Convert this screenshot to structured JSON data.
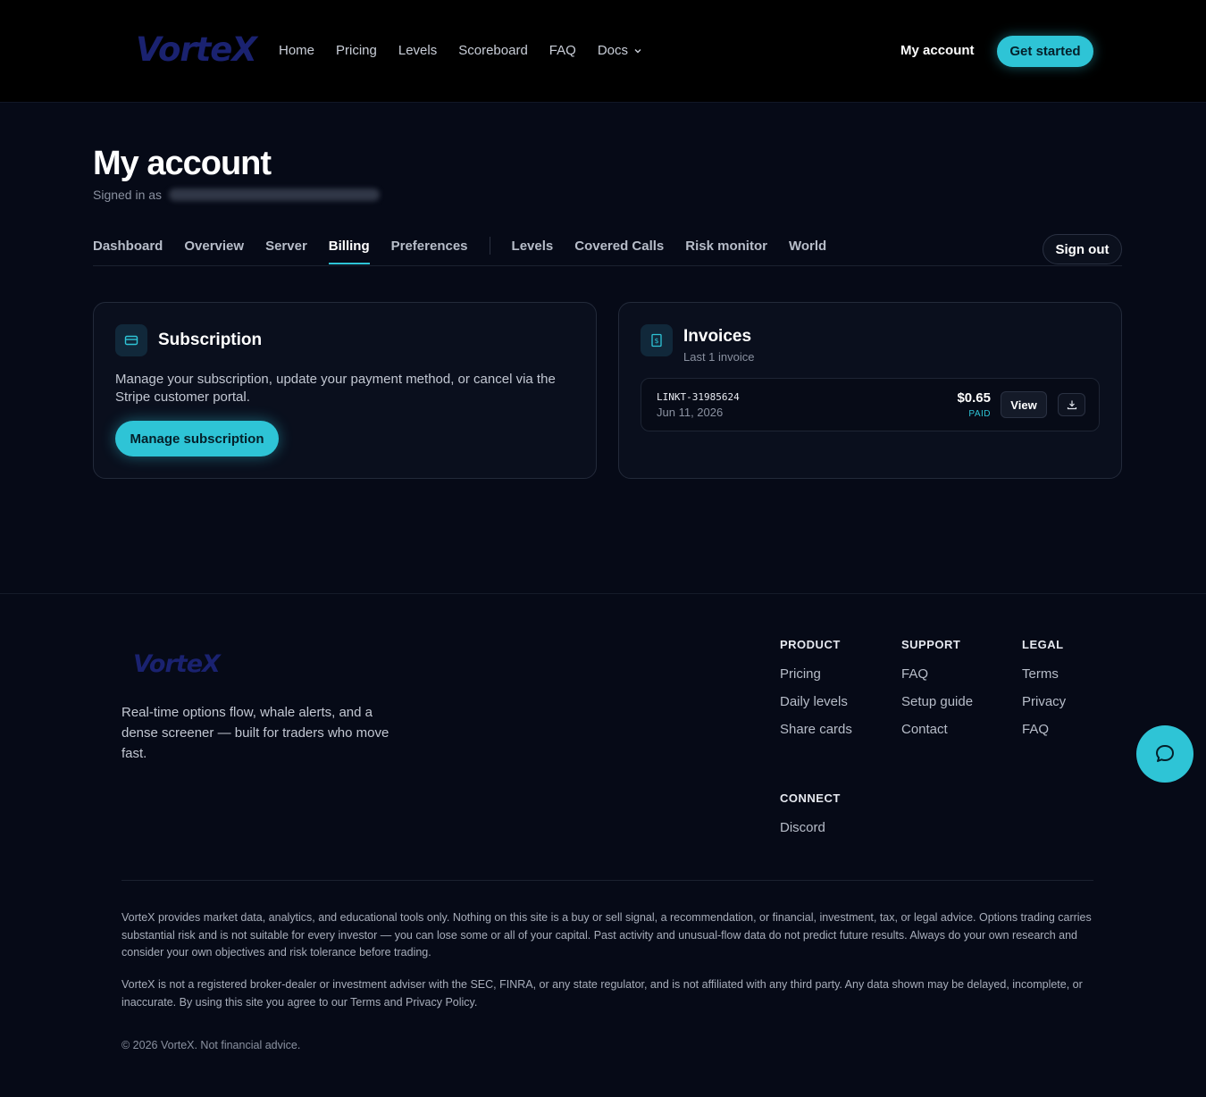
{
  "header": {
    "logo": "VorteX",
    "nav": [
      "Home",
      "Pricing",
      "Levels",
      "Scoreboard",
      "FAQ",
      "Docs"
    ],
    "account_link": "My account",
    "cta": "Get started"
  },
  "main": {
    "title": "My account",
    "signed_in_label": "Signed in as",
    "tabs_left": [
      "Dashboard",
      "Overview",
      "Server",
      "Billing",
      "Preferences"
    ],
    "tabs_right": [
      "Levels",
      "Covered Calls",
      "Risk monitor",
      "World"
    ],
    "active_tab": "Billing",
    "sign_out": "Sign out"
  },
  "subscription": {
    "title": "Subscription",
    "description": "Manage your subscription, update your payment method, or cancel via the Stripe customer portal.",
    "button": "Manage subscription"
  },
  "invoices": {
    "title": "Invoices",
    "subtitle": "Last 1 invoice",
    "items": [
      {
        "id": "LINKT-31985624",
        "date": "Jun 11, 2026",
        "amount": "$0.65",
        "status": "PAID",
        "view_label": "View"
      }
    ]
  },
  "footer": {
    "logo": "VorteX",
    "tagline": "Real-time options flow, whale alerts, and a dense screener — built for traders who move fast.",
    "columns": [
      {
        "heading": "PRODUCT",
        "links": [
          "Pricing",
          "Daily levels",
          "Share cards"
        ]
      },
      {
        "heading": "SUPPORT",
        "links": [
          "FAQ",
          "Setup guide",
          "Contact"
        ]
      },
      {
        "heading": "LEGAL",
        "links": [
          "Terms",
          "Privacy",
          "FAQ"
        ]
      },
      {
        "heading": "CONNECT",
        "links": [
          "Discord"
        ]
      }
    ],
    "disclaimer_1": "VorteX provides market data, analytics, and educational tools only. Nothing on this site is a buy or sell signal, a recommendation, or financial, investment, tax, or legal advice. Options trading carries substantial risk and is not suitable for every investor — you can lose some or all of your capital. Past activity and unusual-flow data do not predict future results. Always do your own research and consider your own objectives and risk tolerance before trading.",
    "disclaimer_2": "VorteX is not a registered broker-dealer or investment adviser with the SEC, FINRA, or any state regulator, and is not affiliated with any third party. Any data shown may be delayed, incomplete, or inaccurate. By using this site you agree to our Terms and Privacy Policy.",
    "copyright": "© 2026 VorteX. Not financial advice."
  },
  "colors": {
    "accent": "#2ec4d6",
    "background": "#060a17",
    "header_bg": "#000000",
    "logo": "#1a2270"
  },
  "icons": [
    "chevron-down-icon",
    "credit-card-icon",
    "receipt-icon",
    "download-icon",
    "chat-icon"
  ]
}
